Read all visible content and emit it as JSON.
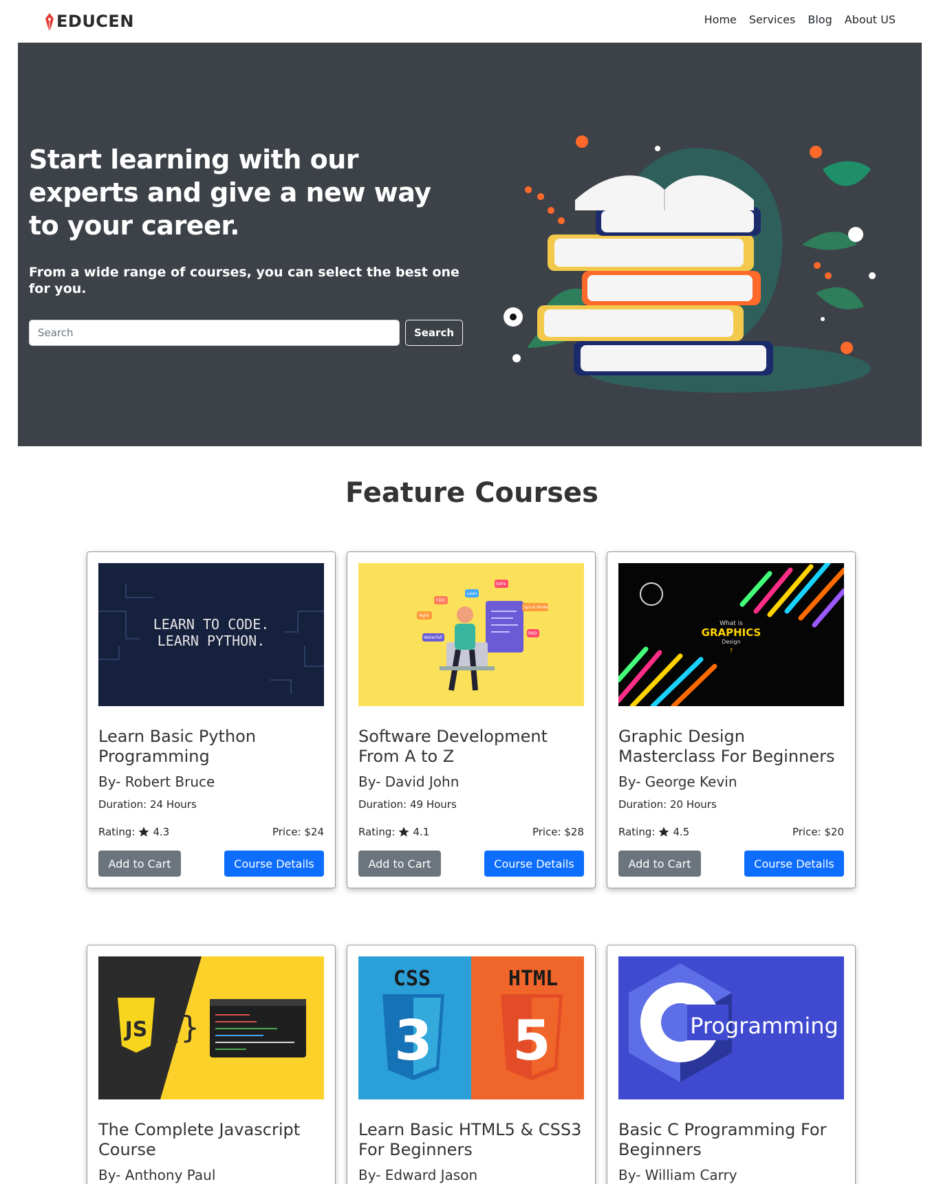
{
  "navbar": {
    "brand": "EDUCEN",
    "links": [
      "Home",
      "Services",
      "Blog",
      "About US"
    ]
  },
  "hero": {
    "title": "Start learning with our experts and give a new way to your career.",
    "subtitle": "From a wide range of courses, you can select the best one for you.",
    "search_placeholder": "Search",
    "search_button": "Search"
  },
  "section": {
    "title": "Feature Courses"
  },
  "courses": [
    {
      "title": "Learn Basic Python Programming",
      "author": "By- Robert Bruce",
      "duration": "Duration: 24 Hours",
      "rating_label": "Rating:",
      "rating": "4.3",
      "price": "Price: $24",
      "cart_label": "Add to Cart",
      "details_label": "Course Details",
      "image_text": [
        "LEARN TO CODE.",
        "LEARN PYTHON."
      ]
    },
    {
      "title": "Software Development From A to Z",
      "author": "By- David John",
      "duration": "Duration: 49 Hours",
      "rating_label": "Rating:",
      "rating": "4.1",
      "price": "Price: $28",
      "cart_label": "Add to Cart",
      "details_label": "Course Details",
      "image_text": [
        "FDD",
        "Lean",
        "SAFe",
        "Agile",
        "Spiral Model",
        "Waterfall",
        "RAD"
      ]
    },
    {
      "title": "Graphic Design Masterclass For Beginners",
      "author": "By- George Kevin",
      "duration": "Duration: 20 Hours",
      "rating_label": "Rating:",
      "rating": "4.5",
      "price": "Price: $20",
      "cart_label": "Add to Cart",
      "details_label": "Course Details",
      "image_text": [
        "What is",
        "GRAPHICS",
        "Design",
        "?"
      ]
    },
    {
      "title": "The Complete Javascript Course",
      "author": "By- Anthony Paul",
      "image_text": [
        "JS"
      ]
    },
    {
      "title": "Learn Basic HTML5 & CSS3 For Beginners",
      "author": "By- Edward Jason",
      "image_text": [
        "CSS",
        "HTML"
      ]
    },
    {
      "title": "Basic C Programming For Beginners",
      "author": "By- William Carry",
      "image_text": [
        "Programming"
      ]
    }
  ],
  "colors": {
    "hero_bg": "#3d4148",
    "primary": "#0d6efd",
    "secondary": "#6c757d"
  }
}
